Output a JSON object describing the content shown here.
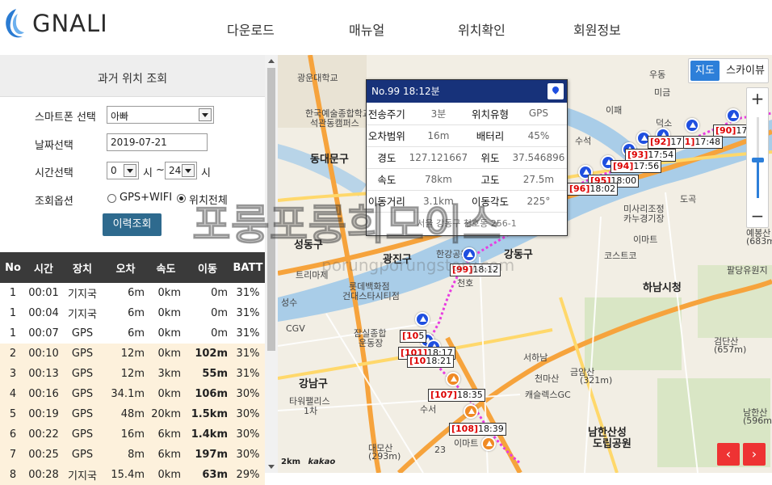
{
  "brand": {
    "name": "GNALI"
  },
  "nav": [
    "다운로드",
    "매뉴얼",
    "위치확인",
    "회원정보"
  ],
  "panel": {
    "title": "과거 위치 조회",
    "labels": {
      "phone": "스마트폰 선택",
      "date": "날짜선택",
      "time": "시간선택",
      "option": "조회옵션"
    },
    "phone_value": "아빠",
    "date_value": "2019-07-21",
    "time_from": "0",
    "time_to": "24",
    "hour_unit": "시",
    "tilde": "~",
    "radio_gps_wifi": "GPS+WIFI",
    "radio_all": "위치전체",
    "selected_option": "위치전체",
    "search_button": "이력조회"
  },
  "table": {
    "headers": [
      "No",
      "시간",
      "장치",
      "오차",
      "속도",
      "이동",
      "BATT"
    ],
    "rows": [
      {
        "no": "1",
        "time": "00:01",
        "device": "기지국",
        "err": "6m",
        "speed": "0km",
        "move": "0m",
        "batt": "31%",
        "hl": false
      },
      {
        "no": "1",
        "time": "00:04",
        "device": "기지국",
        "err": "6m",
        "speed": "0km",
        "move": "0m",
        "batt": "31%",
        "hl": false
      },
      {
        "no": "1",
        "time": "00:07",
        "device": "GPS",
        "err": "6m",
        "speed": "0km",
        "move": "0m",
        "batt": "31%",
        "hl": false
      },
      {
        "no": "2",
        "time": "00:10",
        "device": "GPS",
        "err": "12m",
        "speed": "0km",
        "move": "102m",
        "batt": "31%",
        "hl": true
      },
      {
        "no": "3",
        "time": "00:13",
        "device": "GPS",
        "err": "12m",
        "speed": "3km",
        "move": "55m",
        "batt": "31%",
        "hl": true
      },
      {
        "no": "4",
        "time": "00:16",
        "device": "GPS",
        "err": "34.1m",
        "speed": "0km",
        "move": "106m",
        "batt": "30%",
        "hl": true
      },
      {
        "no": "5",
        "time": "00:19",
        "device": "GPS",
        "err": "48m",
        "speed": "20km",
        "move": "1.5km",
        "batt": "30%",
        "hl": true
      },
      {
        "no": "6",
        "time": "00:22",
        "device": "GPS",
        "err": "16m",
        "speed": "6km",
        "move": "1.4km",
        "batt": "30%",
        "hl": true
      },
      {
        "no": "7",
        "time": "00:25",
        "device": "GPS",
        "err": "8m",
        "speed": "6km",
        "move": "197m",
        "batt": "30%",
        "hl": true
      },
      {
        "no": "8",
        "time": "00:28",
        "device": "기지국",
        "err": "15.4m",
        "speed": "0km",
        "move": "63m",
        "batt": "29%",
        "hl": true
      }
    ]
  },
  "map": {
    "type_on": "지도",
    "type_off": "스카이뷰",
    "zoom_plus": "+",
    "zoom_minus": "−",
    "info": {
      "title": "No.99  18:12분",
      "rows": [
        [
          "전송주기",
          "3분",
          "위치유형",
          "GPS"
        ],
        [
          "오차범위",
          "16m",
          "배터리",
          "45%"
        ],
        [
          "경도",
          "127.121667",
          "위도",
          "37.546896"
        ],
        [
          "속도",
          "78km",
          "고도",
          "27.5m"
        ],
        [
          "이동거리",
          "3.1km",
          "이동각도",
          "225°"
        ]
      ],
      "address": "서울 강동구 천호동 256-1"
    },
    "tags": [
      {
        "n": "[90]",
        "t": "17:"
      },
      {
        "n": "[91]",
        "t": "17:48"
      },
      {
        "n": "[92]",
        "t": "17"
      },
      {
        "n": "[93]",
        "t": "17:54"
      },
      {
        "n": "[94]",
        "t": "17:56"
      },
      {
        "n": "[95]",
        "t": "18:00"
      },
      {
        "n": "[96]",
        "t": "18:02"
      },
      {
        "n": "[99]",
        "t": "18:12"
      },
      {
        "n": "[10",
        "t": "5"
      },
      {
        "n": "[101]",
        "t": "18:17"
      },
      {
        "n": "[10",
        "t": "18:21"
      },
      {
        "n": "[107]",
        "t": "18:35"
      },
      {
        "n": "[108]",
        "t": "18:39"
      }
    ],
    "places": [
      "광운대학교",
      "한국예술종합학교",
      "석관동캠퍼스",
      "동대문구",
      "성동구",
      "광진구",
      "트리마제",
      "롯데백화점",
      "건대스타시티점",
      "잠실종합",
      "운동장",
      "강남구",
      "타워팰리스",
      "1차",
      "수서",
      "이마트",
      "하남시청",
      "미사리조정",
      "카누경기장",
      "코스트코",
      "이마트",
      "도곡",
      "팔당유원지",
      "검단산",
      "(657m)",
      "금암산",
      "(321m)",
      "천마산",
      "서하남",
      "캐슬렉스GC",
      "남한산성",
      "도립공원",
      "예봉산",
      "(683m)",
      "남한산",
      "(596m)",
      "대모산",
      "(293m)",
      "성수",
      "CGV",
      "강동구",
      "천호",
      "한강공원",
      "이패",
      "수석",
      "덕소",
      "미금",
      "우동",
      "23"
    ],
    "scale": "2km",
    "provider": "kakao",
    "nav_prev": "‹",
    "nav_next": "›"
  },
  "watermark": {
    "main": "포룽포룽희모이스",
    "sub": "porungporungstory.com"
  },
  "colors": {
    "header_nav": "#333333",
    "table_head": "#3a3a3a",
    "highlight_row": "#fdf1dc",
    "button": "#2e6a8e",
    "info_head": "#17327a",
    "marker_blue": "#1f4fe0",
    "marker_orange": "#f08a24"
  }
}
